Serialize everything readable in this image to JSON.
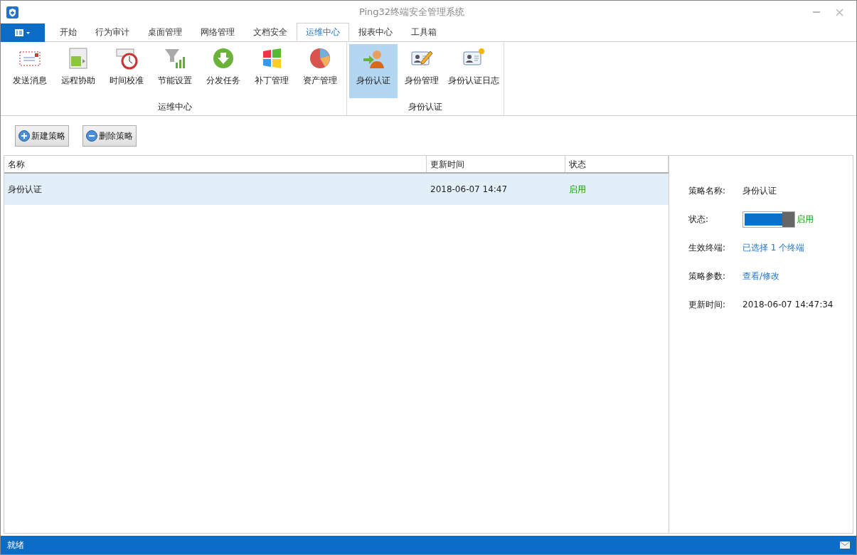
{
  "window": {
    "title": "Ping32终端安全管理系统"
  },
  "tabs": [
    {
      "label": "开始",
      "selected": false
    },
    {
      "label": "行为审计",
      "selected": false
    },
    {
      "label": "桌面管理",
      "selected": false
    },
    {
      "label": "网络管理",
      "selected": false
    },
    {
      "label": "文档安全",
      "selected": false
    },
    {
      "label": "运维中心",
      "selected": true
    },
    {
      "label": "报表中心",
      "selected": false
    },
    {
      "label": "工具箱",
      "selected": false
    }
  ],
  "ribbon_groups": [
    {
      "title": "运维中心",
      "items": [
        {
          "label": "发送消息",
          "selected": false
        },
        {
          "label": "远程协助",
          "selected": false
        },
        {
          "label": "时间校准",
          "selected": false
        },
        {
          "label": "节能设置",
          "selected": false
        },
        {
          "label": "分发任务",
          "selected": false
        },
        {
          "label": "补丁管理",
          "selected": false
        },
        {
          "label": "资产管理",
          "selected": false
        }
      ]
    },
    {
      "title": "身份认证",
      "items": [
        {
          "label": "身份认证",
          "selected": true
        },
        {
          "label": "身份管理",
          "selected": false
        },
        {
          "label": "身份认证日志",
          "selected": false
        }
      ]
    }
  ],
  "toolbar": [
    {
      "label": "新建策略",
      "kind": "add"
    },
    {
      "label": "删除策略",
      "kind": "remove"
    }
  ],
  "table": {
    "columns": [
      "名称",
      "更新时间",
      "状态"
    ],
    "rows": [
      {
        "cells": [
          "身份认证",
          "2018-06-07 14:47",
          "启用"
        ],
        "selected": true
      }
    ]
  },
  "details": {
    "name_label": "策略名称:",
    "name": "身份认证",
    "status_label": "状态:",
    "status_on": true,
    "status_text": "启用",
    "terminals_label": "生效终端:",
    "terminals_link": "已选择 1 个终端",
    "params_label": "策略参数:",
    "params_link": "查看/修改",
    "time_label": "更新时间:",
    "time": "2018-06-07 14:47:34"
  },
  "status_bar": {
    "text": "就绪"
  }
}
